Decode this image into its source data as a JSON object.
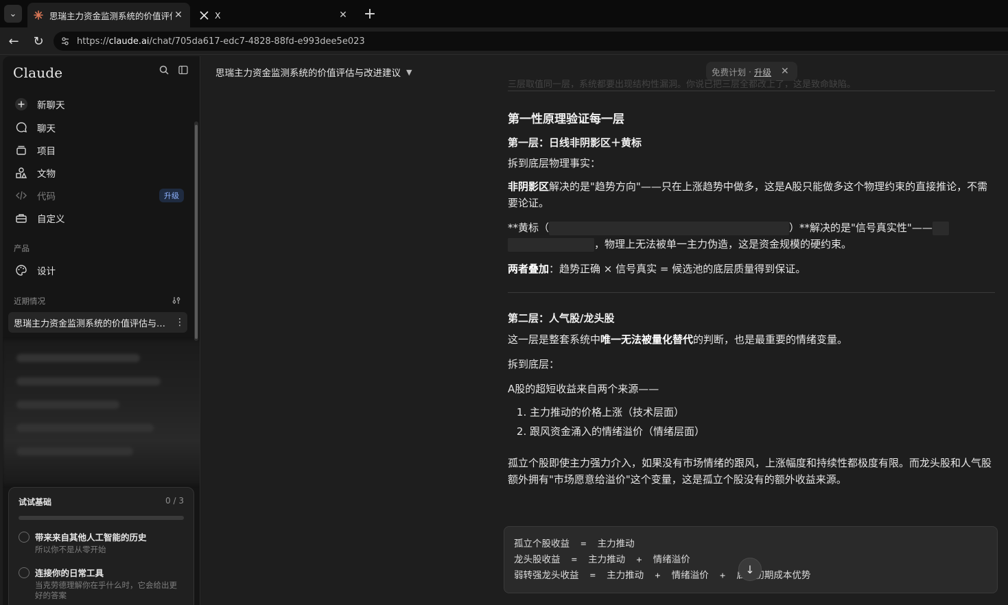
{
  "browser": {
    "tabs": [
      {
        "title": "思瑞主力资金监测系统的价值评估",
        "active": true
      },
      {
        "title": "X",
        "active": false
      }
    ],
    "url_scheme": "https://",
    "url_host": "claude.ai",
    "url_path": "/chat/705da617-edc7-4828-88fd-e993dee5e023"
  },
  "sidebar": {
    "brand": "Claude",
    "nav": [
      {
        "label": "新聊天",
        "icon": "plus-icon"
      },
      {
        "label": "聊天",
        "icon": "chat-icon"
      },
      {
        "label": "项目",
        "icon": "projects-icon"
      },
      {
        "label": "文物",
        "icon": "artifacts-icon"
      },
      {
        "label": "代码",
        "icon": "code-icon",
        "badge": "升级"
      },
      {
        "label": "自定义",
        "icon": "customize-icon"
      }
    ],
    "section_product": "产品",
    "product_item": {
      "label": "设计",
      "icon": "palette-icon"
    },
    "section_recent": "近期情况",
    "recent_item": "思瑞主力资金监测系统的价值评估与改进建议",
    "onboarding": {
      "title": "试试基础",
      "count": "0 / 3",
      "tasks": [
        {
          "title": "带来来自其他人工智能的历史",
          "desc": "所以你不是从零开始"
        },
        {
          "title": "连接你的日常工具",
          "desc": "当克劳德理解你在乎什么时，它会给出更好的答案"
        }
      ]
    }
  },
  "main": {
    "conversation_title": "思瑞主力资金监测系统的价值评估与改进建议",
    "plan_label": "免费计划",
    "plan_sep": "·",
    "plan_upgrade": "升级",
    "ghost_line": "三层取值同一层，系统都要出现结构性漏洞。你说已把三层全都改上了，这是致命缺陷。",
    "section_heading": "第一性原理验证每一层",
    "layer1_title": "第一层：日线非阴影区＋黄标",
    "layer1_intro": "拆到底层物理事实：",
    "layer1_p1_bold": "非阴影区",
    "layer1_p1_rest": "解决的是\"趋势方向\"——只在上涨趋势中做多，这是A股只能做多这个物理约束的直接推论，不需要论证。",
    "layer1_p2_a": "**黄标（",
    "layer1_p2_b": "）**解决的是\"信号真实性\"——",
    "layer1_p2_c": "，物理上无法被单一主力伪造，这是资金规模的硬约束。",
    "layer1_p3_bold": "两者叠加",
    "layer1_p3_rest": "：趋势正确 × 信号真实 = 候选池的底层质量得到保证。",
    "layer2_title": "第二层：人气股/龙头股",
    "layer2_p1_a": "这一层是整套系统中",
    "layer2_p1_bold": "唯一无法被量化替代",
    "layer2_p1_b": "的判断，也是最重要的情绪变量。",
    "layer2_intro": "拆到底层：",
    "layer2_sources": "A股的超短收益来自两个来源——",
    "layer2_list": [
      "主力推动的价格上涨（技术层面）",
      "跟风资金涌入的情绪溢价（情绪层面）"
    ],
    "layer2_p2": "孤立个股即使主力强力介入，如果没有市场情绪的跟风，上涨幅度和持续性都极度有限。而龙头股和人气股额外拥有\"市场愿意给溢价\"这个变量，这是孤立个股没有的额外收益来源。",
    "code_lines": [
      "孤立个股收益  =  主力推动",
      "龙头股收益  =  主力推动  +  情绪溢价",
      "弱转强龙头收益  =  主力推动  +  情绪溢价  +  启动初期成本优势"
    ]
  },
  "colors": {
    "accent_claude": "#d97757",
    "badge_text": "#8fb3ff"
  }
}
